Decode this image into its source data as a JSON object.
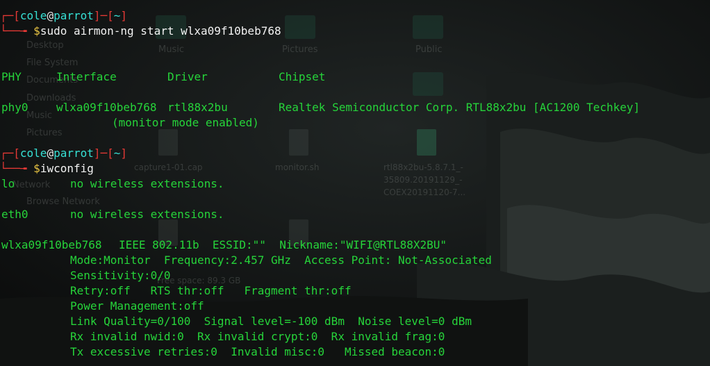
{
  "terminal": {
    "prompt": {
      "user": "cole",
      "at": "@",
      "host": "parrot",
      "dir": "~"
    },
    "commands": [
      "sudo airmon-ng start wlxa09f10beb768",
      "iwconfig"
    ],
    "airmon_table": {
      "headers": [
        "PHY",
        "Interface",
        "Driver",
        "Chipset"
      ],
      "row": {
        "phy": "phy0",
        "interface": "wlxa09f10beb768",
        "driver": "rtl88x2bu",
        "chipset": "Realtek Semiconductor Corp. RTL88x2bu [AC1200 Techkey]"
      },
      "note": "(monitor mode enabled)"
    },
    "iwconfig_output": [
      {
        "iface": "lo",
        "info": "no wireless extensions."
      },
      {
        "iface": "eth0",
        "info": "no wireless extensions."
      }
    ],
    "wireless": {
      "iface": "wlxa09f10beb768",
      "header": "IEEE 802.11b  ESSID:\"\"  Nickname:\"WIFI@RTL88X2BU\"",
      "details": [
        "Mode:Monitor  Frequency:2.457 GHz  Access Point: Not-Associated",
        "Sensitivity:0/0",
        "Retry:off   RTS thr:off   Fragment thr:off",
        "Power Management:off",
        "Link Quality=0/100  Signal level=-100 dBm  Noise level=0 dBm",
        "Rx invalid nwid:0  Rx invalid crypt:0  Rx invalid frag:0",
        "Tx excessive retries:0  Invalid misc:0   Missed beacon:0"
      ]
    }
  },
  "background_window": {
    "sidebar": [
      "Desktop",
      "File System",
      "Documents",
      "Downloads",
      "Music",
      "Pictures",
      "Network",
      "Browse Network"
    ],
    "folders": [
      "Music",
      "Pictures",
      "Public"
    ],
    "files": [
      "capture1-01.cap",
      "monitor.sh",
      "rtl88x2bu-5.8.7.1_-",
      "35809.20191129_-",
      "COEX20191120-7..."
    ],
    "free_space": "Free space: 89.3 GB"
  },
  "colors": {
    "output_green": "#26d43a",
    "prompt_red": "#e53935",
    "prompt_cyan": "#36e0d4",
    "dollar_yellow": "#e8c443"
  }
}
